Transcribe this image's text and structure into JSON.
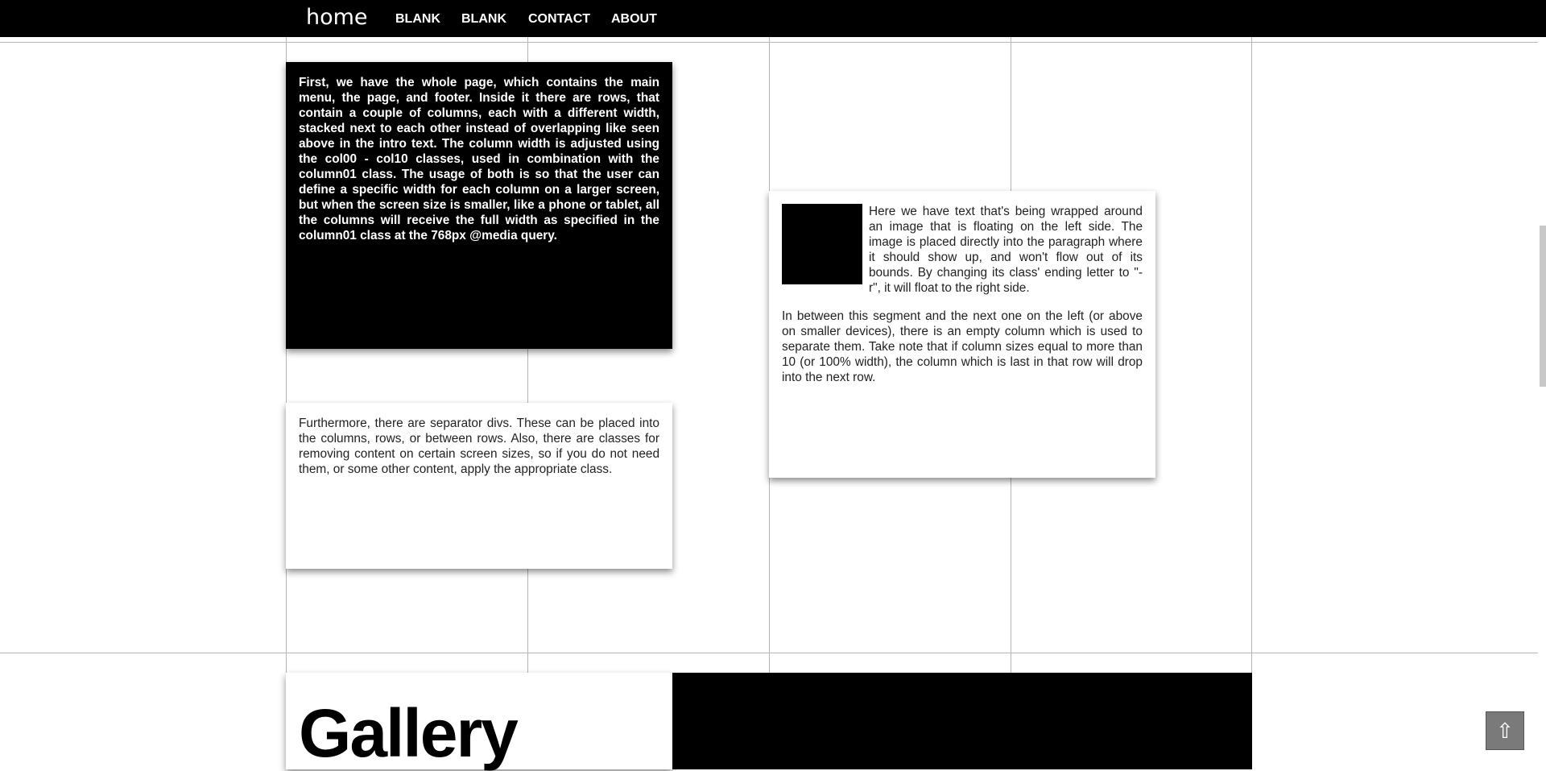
{
  "nav": {
    "home": "home",
    "items": [
      {
        "label": "BLANK"
      },
      {
        "label": "BLANK"
      },
      {
        "label": "CONTACT"
      },
      {
        "label": "ABOUT"
      }
    ]
  },
  "cards": {
    "intro": "First, we have the whole page, which contains the main menu, the page, and footer. Inside it there are rows, that contain a couple of columns, each with a different width, stacked next to each other instead of overlapping like seen above in the intro text. The column width is adjusted using the col00 - col10 classes, used in combination with the column01 class. The usage of both is so that the user can define a specific width for each column on a larger screen, but when the screen size is smaller, like a phone or tablet, all the columns will receive the full width as specified in the column01 class at the 768px @media query.",
    "separator": "Furthermore, there are separator divs. These can be placed into the columns, rows, or between rows. Also, there are classes for removing content on certain screen sizes, so if you do not need them, or some other content, apply the appropriate class.",
    "float_p1": "Here we have text that's being wrapped around an image that is floating on the left side. The image is placed directly into the paragraph where it should show up, and won't flow out of its bounds. By changing its class' ending letter to \"-r\", it will float to the right side.",
    "float_p2": "In between this segment and the next one on the left (or above on smaller devices), there is an empty column which is used to separate them. Take note that if column sizes equal to more than 10 (or 100% width), the column which is last in that row will drop into the next row."
  },
  "gallery": {
    "title": "Gallery"
  },
  "back_to_top": {
    "icon": "⇧"
  },
  "colors": {
    "bar": "#000000",
    "grid": "#b5b5b5",
    "button": "#7a7a7a"
  }
}
